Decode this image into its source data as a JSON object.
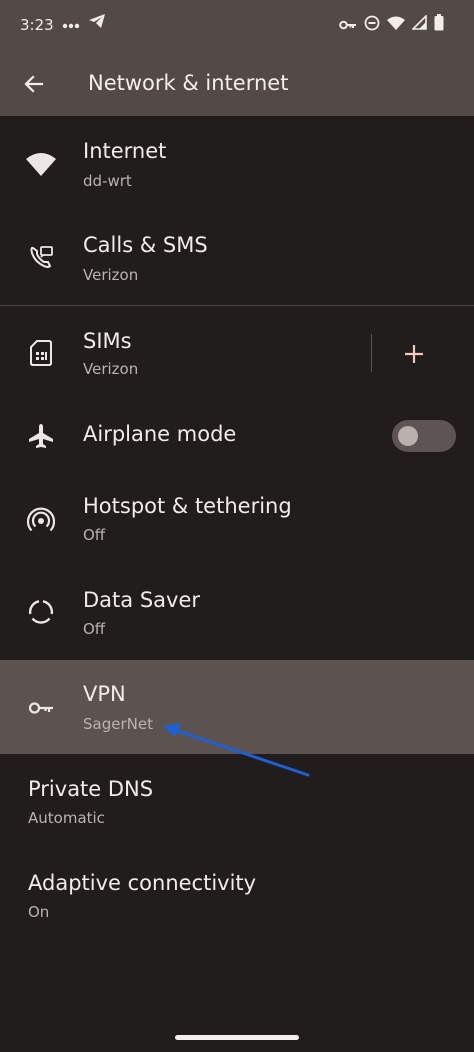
{
  "status_bar": {
    "time": "3:23",
    "left_icons": [
      "more-dots-icon",
      "telegram-icon"
    ],
    "right_icons": [
      "vpn-key-icon",
      "do-not-disturb-icon",
      "wifi-icon",
      "signal-icon",
      "battery-icon"
    ]
  },
  "header": {
    "back_icon": "arrow-back-icon",
    "title": "Network & internet"
  },
  "items": [
    {
      "id": "internet",
      "icon": "wifi-icon",
      "title": "Internet",
      "subtitle": "dd-wrt"
    },
    {
      "id": "calls-sms",
      "icon": "calls-sms-icon",
      "title": "Calls & SMS",
      "subtitle": "Verizon"
    },
    {
      "id": "sims",
      "icon": "sim-card-icon",
      "title": "SIMs",
      "subtitle": "Verizon",
      "action": "+"
    },
    {
      "id": "airplane-mode",
      "icon": "airplane-icon",
      "title": "Airplane mode",
      "toggle_on": false
    },
    {
      "id": "hotspot",
      "icon": "hotspot-icon",
      "title": "Hotspot & tethering",
      "subtitle": "Off"
    },
    {
      "id": "data-saver",
      "icon": "data-saver-icon",
      "title": "Data Saver",
      "subtitle": "Off"
    },
    {
      "id": "vpn",
      "icon": "vpn-key-icon",
      "title": "VPN",
      "subtitle": "SagerNet",
      "highlighted": true
    },
    {
      "id": "private-dns",
      "title": "Private DNS",
      "subtitle": "Automatic"
    },
    {
      "id": "adaptive-connectivity",
      "title": "Adaptive connectivity",
      "subtitle": "On"
    }
  ],
  "colors": {
    "background": "#221d1d",
    "app_bar": "#524a47",
    "highlight": "#5b5350",
    "annotation_arrow": "#1f5fd6"
  }
}
